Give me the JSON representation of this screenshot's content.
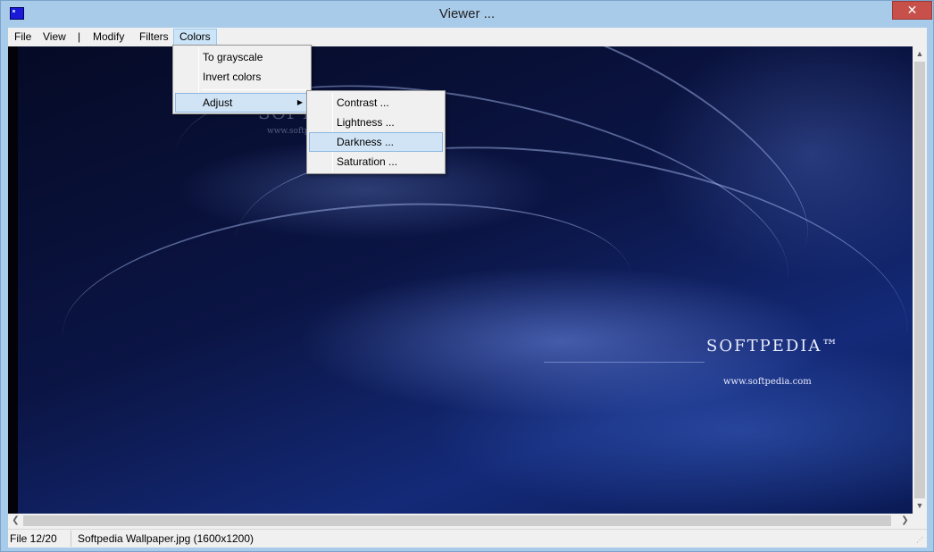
{
  "window": {
    "title": "Viewer ...",
    "close_glyph": "✕"
  },
  "menubar": {
    "file": "File",
    "view": "View",
    "separator": "|",
    "modify": "Modify",
    "filters": "Filters",
    "colors": "Colors"
  },
  "colors_menu": {
    "to_grayscale": "To grayscale",
    "invert_colors": "Invert colors",
    "adjust": "Adjust"
  },
  "adjust_menu": {
    "contrast": "Contrast ...",
    "lightness": "Lightness ...",
    "darkness": "Darkness ...",
    "saturation": "Saturation ..."
  },
  "image": {
    "watermark_small": "SOFTPEDIA",
    "watermark_small_url": "www.softpedia.com",
    "brand": "SOFTPEDIA™",
    "brand_url": "www.softpedia.com"
  },
  "statusbar": {
    "file_index": "File 12/20",
    "file_info": "Softpedia Wallpaper.jpg  (1600x1200)"
  },
  "colors": {
    "titlebar": "#a9cbea",
    "close_button": "#c7504a",
    "menu_highlight": "#d1e4f6"
  }
}
